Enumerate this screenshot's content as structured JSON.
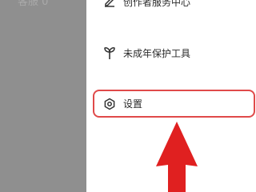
{
  "backdrop": {
    "label": "客服 0"
  },
  "menu": {
    "items": [
      {
        "label": "创作者服务中心",
        "icon": "edit-icon"
      },
      {
        "label": "未成年保护工具",
        "icon": "sprout-icon"
      },
      {
        "label": "设置",
        "icon": "settings-icon",
        "highlighted": true
      }
    ]
  },
  "annotation": {
    "highlight_color": "#e04a4a",
    "arrow_color": "#e02020"
  }
}
